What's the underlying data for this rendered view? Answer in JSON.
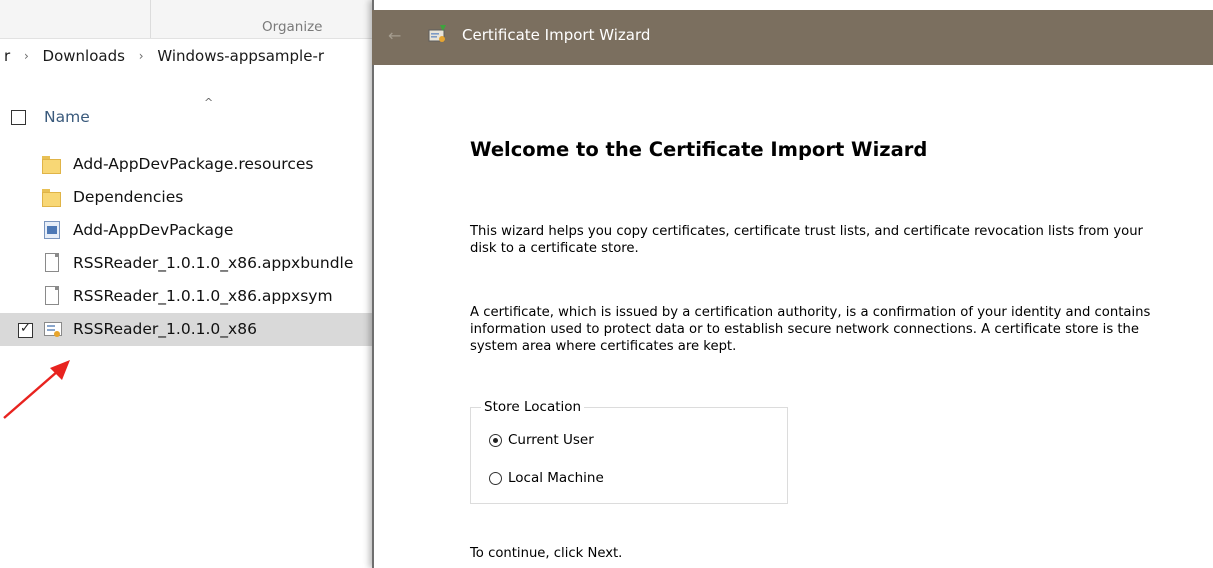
{
  "explorer": {
    "ribbon": {
      "organize_label": "Organize"
    },
    "breadcrumb": {
      "partial_first": "r",
      "separator": "›",
      "items": [
        "Downloads",
        "Windows-appsample-r"
      ]
    },
    "columns": {
      "name_label": "Name",
      "sort_indicator": "^"
    },
    "files": [
      {
        "name": "Add-AppDevPackage.resources",
        "icon": "folder-icon",
        "checked": false,
        "selected": false
      },
      {
        "name": "Dependencies",
        "icon": "folder-icon",
        "checked": false,
        "selected": false
      },
      {
        "name": "Add-AppDevPackage",
        "icon": "powershell-script-icon",
        "checked": false,
        "selected": false
      },
      {
        "name": "RSSReader_1.0.1.0_x86.appxbundle",
        "icon": "file-icon",
        "checked": false,
        "selected": false
      },
      {
        "name": "RSSReader_1.0.1.0_x86.appxsym",
        "icon": "file-icon",
        "checked": false,
        "selected": false
      },
      {
        "name": "RSSReader_1.0.1.0_x86",
        "icon": "certificate-icon",
        "checked": true,
        "selected": true
      }
    ],
    "check_mark": "✓",
    "annotation_color": "#e8231f"
  },
  "wizard": {
    "title": "Certificate Import Wizard",
    "back_glyph": "←",
    "titlebar_color": "#7b6f5f",
    "heading": "Welcome to the Certificate Import Wizard",
    "intro_text": "This wizard helps you copy certificates, certificate trust lists, and certificate revocation lists from your disk to a certificate store.",
    "description_text": "A certificate, which is issued by a certification authority, is a confirmation of your identity and contains information used to protect data or to establish secure network connections. A certificate store is the system area where certificates are kept.",
    "store_location": {
      "legend": "Store Location",
      "options": [
        {
          "label": "Current User",
          "selected": true
        },
        {
          "label": "Local Machine",
          "selected": false
        }
      ]
    },
    "continue_text": "To continue, click Next."
  }
}
